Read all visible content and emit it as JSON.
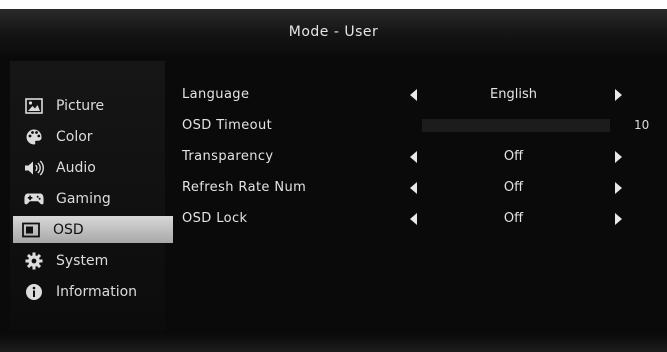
{
  "header": {
    "title": "Mode - User"
  },
  "sidebar": {
    "items": [
      {
        "label": "Picture",
        "icon": "picture-icon"
      },
      {
        "label": "Color",
        "icon": "palette-icon"
      },
      {
        "label": "Audio",
        "icon": "speaker-icon"
      },
      {
        "label": "Gaming",
        "icon": "gamepad-icon"
      },
      {
        "label": "OSD",
        "icon": "osd-icon",
        "active": true
      },
      {
        "label": "System",
        "icon": "gear-icon"
      },
      {
        "label": "Information",
        "icon": "info-icon"
      }
    ]
  },
  "settings": {
    "language": {
      "label": "Language",
      "value": "English"
    },
    "osd_timeout": {
      "label": "OSD Timeout",
      "value": "10",
      "fill_fraction": 0.0
    },
    "transparency": {
      "label": "Transparency",
      "value": "Off"
    },
    "refresh_rate_num": {
      "label": "Refresh Rate Num",
      "value": "Off"
    },
    "osd_lock": {
      "label": "OSD Lock",
      "value": "Off"
    }
  },
  "colors": {
    "active_item_bg": "#c4c4c4",
    "osd_bg": "#0a0a0a",
    "text": "#e4e4e4"
  }
}
